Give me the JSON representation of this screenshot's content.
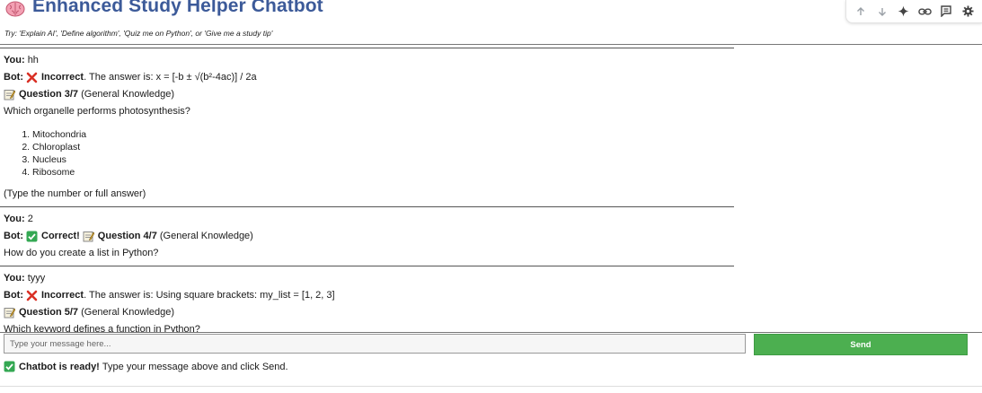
{
  "app": {
    "title": "Enhanced Study Helper Chatbot",
    "hint": "Try: 'Explain AI', 'Define algorithm', 'Quiz me on Python', or 'Give me a study tip'"
  },
  "toolbar": {
    "icons": [
      "arrow-up-icon",
      "arrow-down-icon",
      "sparkle-icon",
      "link-icon",
      "comment-icon",
      "gear-icon"
    ]
  },
  "chat": {
    "messages": [
      {
        "you_label": "You:",
        "you_text": "hh",
        "bot_label": "Bot:",
        "verdict": "Incorrect",
        "verdict_rest": ". The answer is: x = [-b ± √(b²-4ac)] / 2a",
        "question_label": "Question 3/7",
        "question_category": "(General Knowledge)",
        "question_text": "Which organelle performs photosynthesis?",
        "options": [
          "Mitochondria",
          "Chloroplast",
          "Nucleus",
          "Ribosome"
        ],
        "instruction": "(Type the number or full answer)"
      },
      {
        "you_label": "You:",
        "you_text": "2",
        "bot_label": "Bot:",
        "verdict": "Correct!",
        "question_label": "Question 4/7",
        "question_category": "(General Knowledge)",
        "question_text": "How do you create a list in Python?"
      },
      {
        "you_label": "You:",
        "you_text": "tyyy",
        "bot_label": "Bot:",
        "verdict": "Incorrect",
        "verdict_rest": ". The answer is: Using square brackets: my_list = [1, 2, 3]",
        "question_label": "Question 5/7",
        "question_category": "(General Knowledge)",
        "question_text": "Which keyword defines a function in Python?"
      }
    ]
  },
  "input": {
    "placeholder": "Type your message here...",
    "value": ""
  },
  "send_button": {
    "label": "Send"
  },
  "status": {
    "bold": "Chatbot is ready!",
    "text": "Type your message above and click Send."
  },
  "colors": {
    "title": "#3c5a99",
    "send_button": "#4caf50",
    "check_green": "#34a853",
    "cross_red": "#d93025"
  }
}
